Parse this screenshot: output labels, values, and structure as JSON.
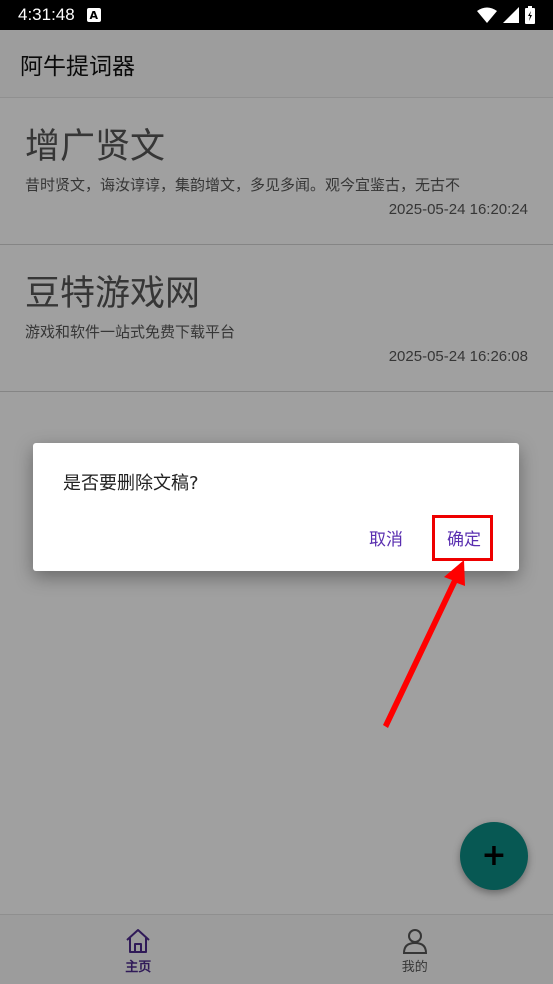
{
  "status_bar": {
    "time": "4:31:48",
    "notification_icon": "A"
  },
  "app_bar": {
    "title": "阿牛提词器"
  },
  "documents": [
    {
      "title": "增广贤文",
      "excerpt": "昔时贤文，诲汝谆谆，集韵增文，多见多闻。观今宜鉴古，无古不",
      "timestamp": "2025-05-24 16:20:24"
    },
    {
      "title": "豆特游戏网",
      "excerpt": "游戏和软件一站式免费下载平台",
      "timestamp": "2025-05-24 16:26:08"
    }
  ],
  "dialog": {
    "message": "是否要删除文稿?",
    "cancel_label": "取消",
    "confirm_label": "确定"
  },
  "fab": {
    "icon": "plus-icon"
  },
  "bottom_nav": [
    {
      "label": "主页",
      "icon": "home-icon",
      "active": true
    },
    {
      "label": "我的",
      "icon": "person-icon",
      "active": false
    }
  ],
  "colors": {
    "accent": "#5a2fb0",
    "fab": "#0c8a82",
    "highlight": "#e00000"
  }
}
